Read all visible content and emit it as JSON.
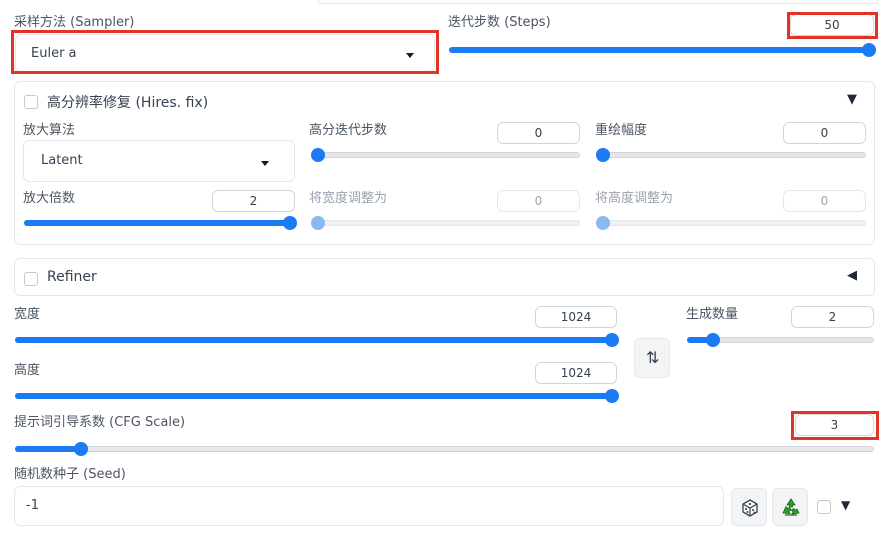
{
  "sampler": {
    "label": "采样方法 (Sampler)",
    "value": "Euler a"
  },
  "steps": {
    "label": "迭代步数 (Steps)",
    "value": "50",
    "fill_fraction": 1.0
  },
  "hires": {
    "label": "高分辨率修复 (Hires. fix)",
    "toggle_glyph": "▼",
    "upscaler": {
      "label": "放大算法",
      "value": "Latent"
    },
    "hires_steps": {
      "label": "高分迭代步数",
      "value": "0",
      "fill_fraction": 0.0
    },
    "denoising": {
      "label": "重绘幅度",
      "value": "0",
      "fill_fraction": 0.0
    },
    "upscale_by": {
      "label": "放大倍数",
      "value": "2",
      "fill_fraction": 1.0
    },
    "resize_width": {
      "label": "将宽度调整为",
      "value": "0",
      "fill_fraction": 0.0
    },
    "resize_height": {
      "label": "将高度调整为",
      "value": "0",
      "fill_fraction": 0.0
    }
  },
  "refiner": {
    "label": "Refiner",
    "toggle_glyph": "◀"
  },
  "width": {
    "label": "宽度",
    "value": "1024",
    "fill_fraction": 1.0
  },
  "height": {
    "label": "高度",
    "value": "1024",
    "fill_fraction": 1.0
  },
  "swap": {
    "icon": "swap-dimensions-icon",
    "glyph": "⇅"
  },
  "batch_count": {
    "label": "生成数量",
    "value": "2",
    "fill_fraction": 0.14
  },
  "cfg": {
    "label": "提示词引导系数 (CFG Scale)",
    "value": "3",
    "fill_fraction": 0.077
  },
  "seed": {
    "label": "随机数种子 (Seed)",
    "value": "-1",
    "dice_icon": "dice-icon",
    "recycle_icon": "recycle-icon",
    "extra_toggle_glyph": "▼"
  },
  "colors": {
    "accent": "#1a7bf2",
    "highlight": "#e53226",
    "recycle": "#2e9e2e"
  }
}
